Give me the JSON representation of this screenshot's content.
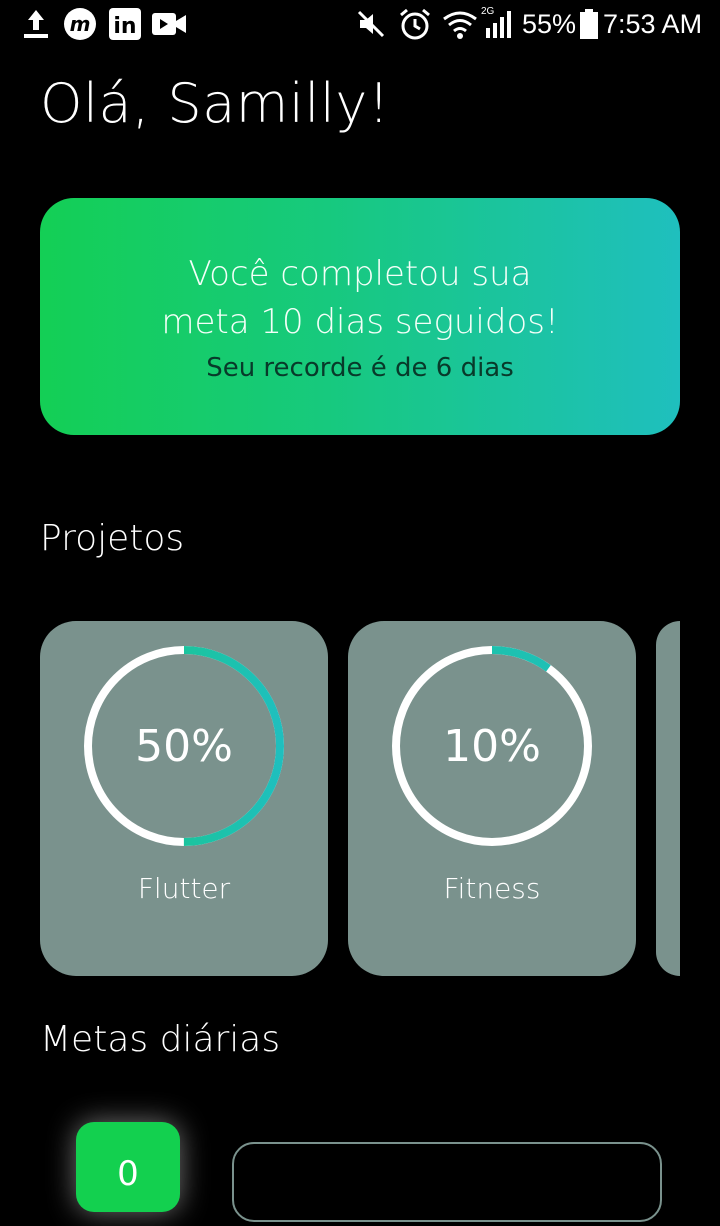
{
  "status_bar": {
    "battery": "55%",
    "time": "7:53 AM",
    "network": "2G",
    "left_icons": [
      "upload-icon",
      "m-app-icon",
      "linkedin-icon",
      "video-icon"
    ],
    "right_icons": [
      "mute-icon",
      "alarm-icon",
      "wifi-icon",
      "signal-icon",
      "battery-icon"
    ]
  },
  "greeting": "Olá, Samilly!",
  "streak_banner": {
    "line1": "Você completou sua",
    "line2": "meta 10 dias seguidos!",
    "record": "Seu recorde é de 6 dias",
    "gradient_start": "#14cf55",
    "gradient_end": "#1fbfbe"
  },
  "projects": {
    "title": "Projetos",
    "items": [
      {
        "label": "Flutter",
        "percent_text": "50%",
        "progress": 0.5
      },
      {
        "label": "Fitness",
        "percent_text": "10%",
        "progress": 0.1
      }
    ]
  },
  "daily_goals": {
    "title": "Metas diárias",
    "first_item_value": "0"
  },
  "colors": {
    "card_bg": "#7a928d",
    "ring_track": "#ffffff",
    "ring_progress_start": "#17c97e",
    "ring_progress_end": "#1fbfbe",
    "accent_green": "#13d04f"
  }
}
